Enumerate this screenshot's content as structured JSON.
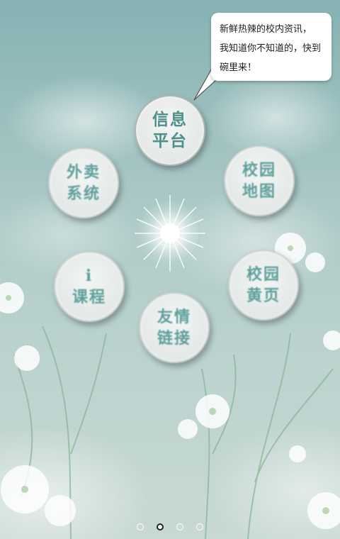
{
  "bubble": {
    "lines": [
      "新鲜热辣的校内资讯，",
      "我知道你不知道的，快到",
      "碗里来！"
    ]
  },
  "nodes": {
    "info": [
      "信息",
      "平台"
    ],
    "takeout": [
      "外卖",
      "系统"
    ],
    "map": [
      "校园",
      "地图"
    ],
    "course": [
      "i",
      "课程"
    ],
    "yellow": [
      "校园",
      "黄页"
    ],
    "links": [
      "友情",
      "链接"
    ]
  },
  "pager": {
    "count": 4,
    "active_index": 1
  },
  "colors": {
    "node_text": "#5fa09c",
    "bubble_bg": "#ffffff"
  }
}
